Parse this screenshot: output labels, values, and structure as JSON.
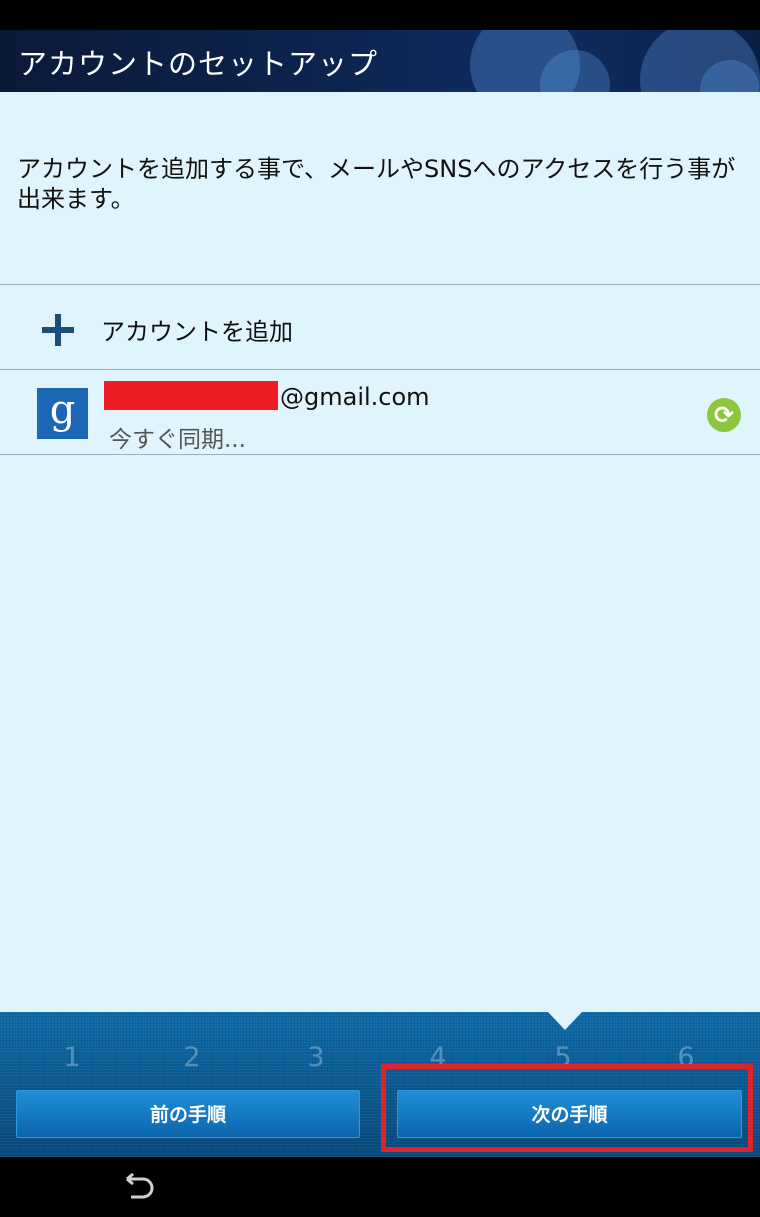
{
  "header": {
    "title": "アカウントのセットアップ"
  },
  "description": "アカウントを追加する事で、メールやSNSへのアクセスを行う事が出来ます。",
  "add_account": {
    "label": "アカウントを追加",
    "icon": "plus-icon"
  },
  "account": {
    "icon": "google-icon",
    "icon_glyph": "g",
    "email_suffix": "@gmail.com",
    "status": "今すぐ同期...",
    "sync_icon": "sync-icon",
    "sync_glyph": "⟳"
  },
  "steps": [
    "1",
    "2",
    "3",
    "4",
    "5",
    "6"
  ],
  "current_step": "5",
  "buttons": {
    "prev": "前の手順",
    "next": "次の手順"
  },
  "nav": {
    "back_icon": "back-icon"
  },
  "colors": {
    "content_bg": "#dff4fc",
    "panel_blue": "#0b5a93",
    "highlight_red": "#e2222b",
    "sync_green": "#8cc63f",
    "google_blue": "#1c68b6"
  }
}
